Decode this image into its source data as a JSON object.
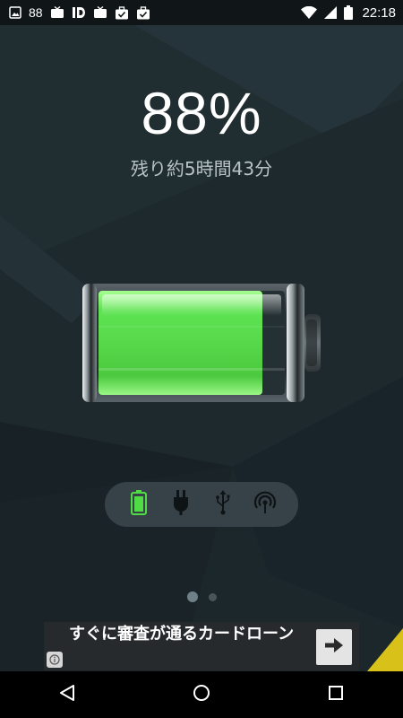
{
  "status_bar": {
    "notification_count": "88",
    "time": "22:18",
    "icons": [
      "image-icon",
      "tv-icon",
      "id-icon",
      "tv-icon",
      "briefcase-check-icon",
      "briefcase-check-icon",
      "wifi-icon",
      "signal-icon",
      "battery-icon"
    ]
  },
  "battery": {
    "percent_text": "88%",
    "level": 0.88,
    "remaining_text": "残り約5時間43分",
    "fill_color": "#5fe65a"
  },
  "modes": [
    {
      "name": "battery-mode",
      "icon": "battery-icon",
      "active": true
    },
    {
      "name": "ac-charging-mode",
      "icon": "plug-icon",
      "active": false
    },
    {
      "name": "usb-charging-mode",
      "icon": "usb-icon",
      "active": false
    },
    {
      "name": "wireless-charging-mode",
      "icon": "wireless-icon",
      "active": false
    }
  ],
  "pager": {
    "pages": 2,
    "current": 1
  },
  "ad": {
    "text": "すぐに審査が通るカードローン",
    "info_icon": "info-icon",
    "arrow_icon": "arrow-right-icon"
  },
  "nav": {
    "buttons": [
      "back-icon",
      "home-icon",
      "recents-icon"
    ]
  },
  "colors": {
    "accent_green": "#5fe65a",
    "background": "#1b2529"
  }
}
